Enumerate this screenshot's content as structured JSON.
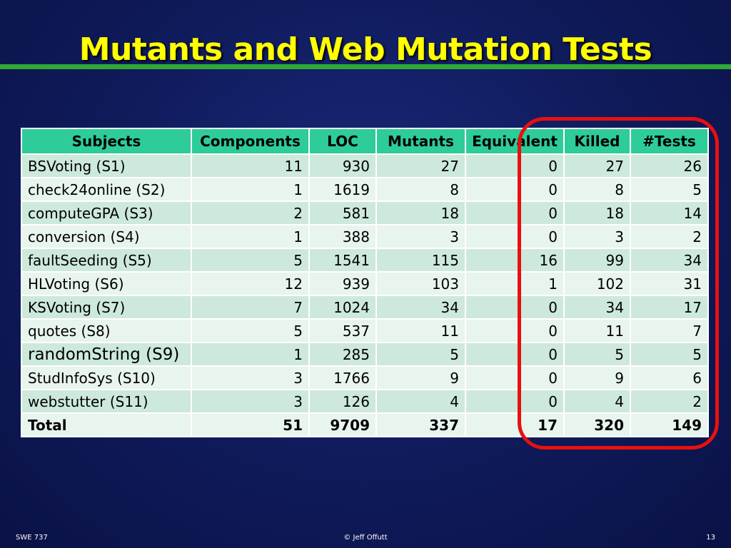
{
  "slide": {
    "title": "Mutants and Web Mutation Tests",
    "footer_left": "SWE 737",
    "footer_center": "© Jeff Offutt",
    "footer_right": "13"
  },
  "table": {
    "headers": [
      "Subjects",
      "Components",
      "LOC",
      "Mutants",
      "Equivalent",
      "Killed",
      "#Tests"
    ],
    "rows": [
      [
        "BSVoting (S1)",
        "11",
        "930",
        "27",
        "0",
        "27",
        "26"
      ],
      [
        "check24online (S2)",
        "1",
        "1619",
        "8",
        "0",
        "8",
        "5"
      ],
      [
        "computeGPA (S3)",
        "2",
        "581",
        "18",
        "0",
        "18",
        "14"
      ],
      [
        "conversion (S4)",
        "1",
        "388",
        "3",
        "0",
        "3",
        "2"
      ],
      [
        "faultSeeding (S5)",
        "5",
        "1541",
        "115",
        "16",
        "99",
        "34"
      ],
      [
        "HLVoting (S6)",
        "12",
        "939",
        "103",
        "1",
        "102",
        "31"
      ],
      [
        "KSVoting (S7)",
        "7",
        "1024",
        "34",
        "0",
        "34",
        "17"
      ],
      [
        "quotes (S8)",
        "5",
        "537",
        "11",
        "0",
        "11",
        "7"
      ],
      [
        "randomString (S9)",
        "1",
        "285",
        "5",
        "0",
        "5",
        "5"
      ],
      [
        "StudInfoSys (S10)",
        "3",
        "1766",
        "9",
        "0",
        "9",
        "6"
      ],
      [
        "webstutter (S11)",
        "3",
        "126",
        "4",
        "0",
        "4",
        "2"
      ]
    ],
    "total": [
      "Total",
      "51",
      "9709",
      "337",
      "17",
      "320",
      "149"
    ]
  },
  "colors": {
    "title": "#ffff00",
    "rule": "#2ea836",
    "header_bg": "#2ecc9a",
    "row_dark": "#cde9dc",
    "row_light": "#e8f4ee",
    "highlight": "#e81010"
  }
}
